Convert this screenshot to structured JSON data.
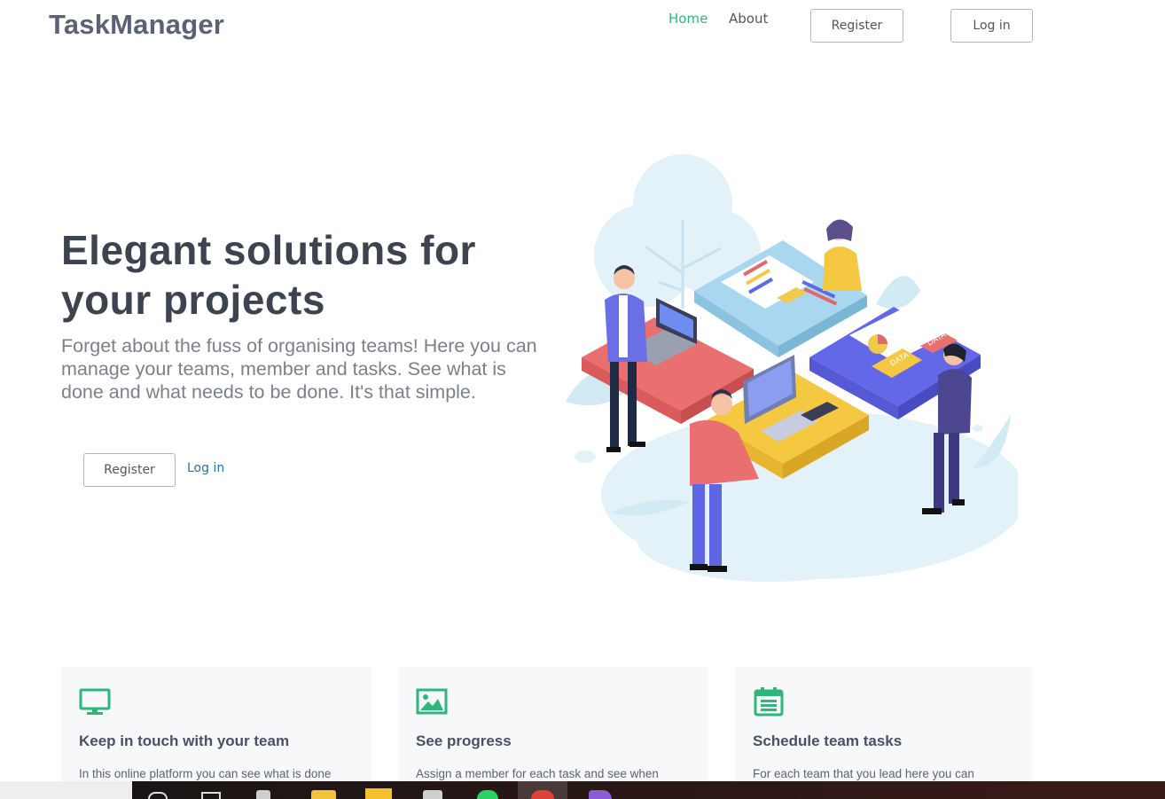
{
  "header": {
    "brand": "TaskManager",
    "nav": {
      "home": "Home",
      "about": "About"
    },
    "register": "Register",
    "login": "Log in"
  },
  "hero": {
    "title": "Elegant solutions for your projects",
    "text": "Forget about the fuss of organising teams! Here you can manage your teams, member and tasks. See what is done and what needs to be done. It's that simple.",
    "register": "Register",
    "login": "Log in",
    "illustration_labels": [
      "DATA",
      "DATA"
    ]
  },
  "features": [
    {
      "icon": "monitor-icon",
      "title": "Keep in touch with your team",
      "text": "In this online platform you can see what is done"
    },
    {
      "icon": "image-icon",
      "title": "See progress",
      "text": "Assign a member for each task and see when"
    },
    {
      "icon": "calendar-icon",
      "title": "Schedule team tasks",
      "text": "For each team that you lead here you can"
    }
  ],
  "colors": {
    "accent": "#2fb67a",
    "link": "#2e6ca4",
    "heading": "#3e4350",
    "body_text": "#7b8089",
    "card_bg": "#f7f8fa"
  },
  "taskbar": {
    "icons": [
      "search-icon",
      "task-view-icon",
      "settings-icon",
      "file-explorer-icon",
      "sticky-notes-icon",
      "store-icon",
      "whatsapp-icon",
      "chrome-icon",
      "visual-studio-icon"
    ]
  }
}
